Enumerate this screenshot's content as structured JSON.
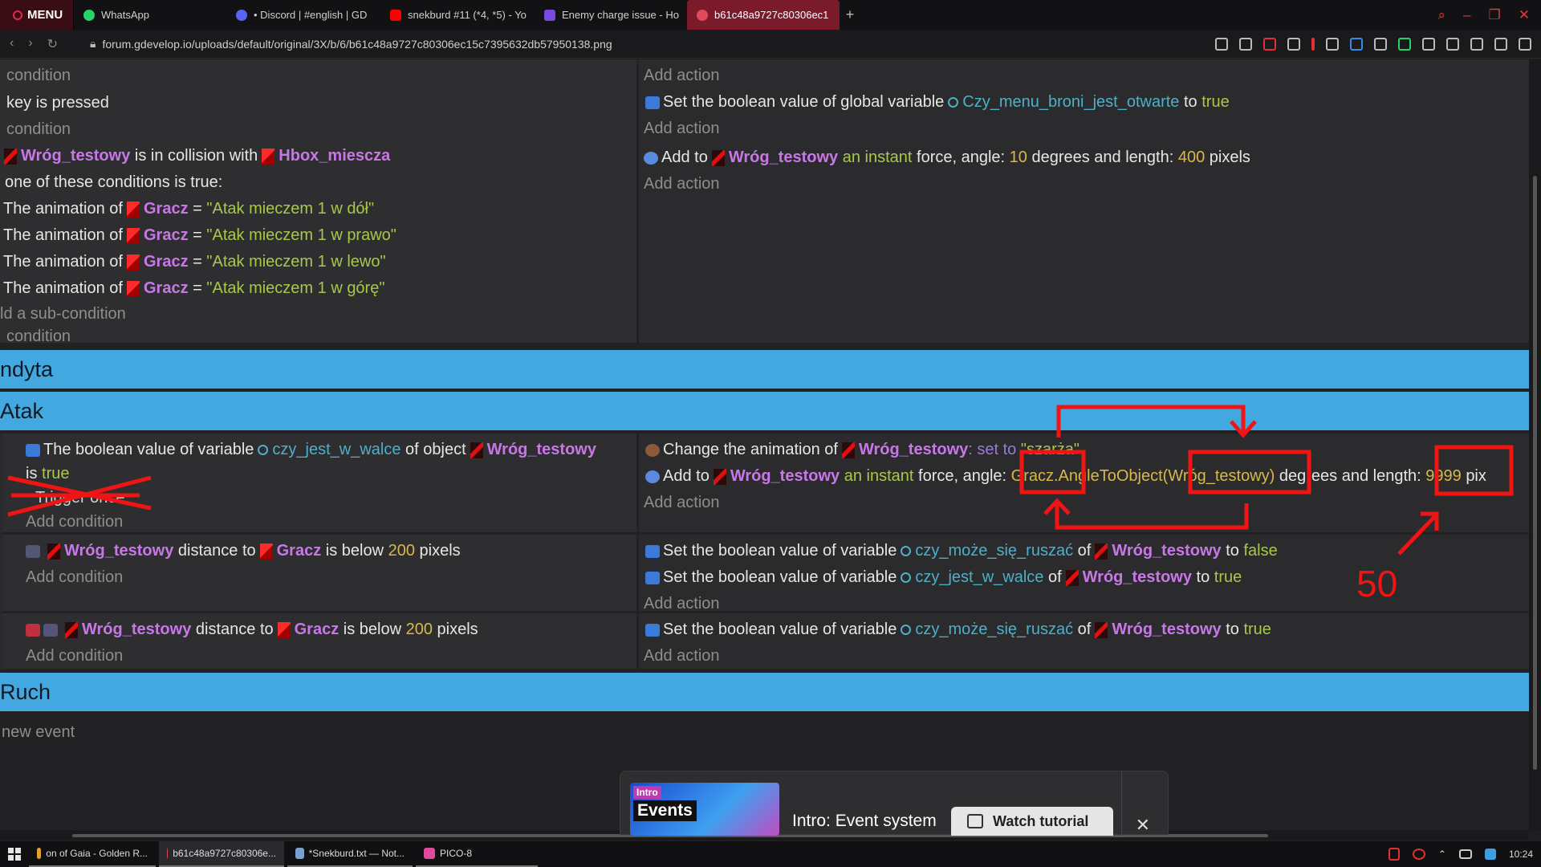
{
  "browser": {
    "menu_label": "MENU",
    "tabs": [
      {
        "label": "WhatsApp",
        "color": "#25d366"
      },
      {
        "label": "• Discord | #english | GD",
        "color": "#5865f2"
      },
      {
        "label": "snekburd #11 (*4, *5) - Yo",
        "color": "#ff0000"
      },
      {
        "label": "Enemy charge issue - Ho",
        "color": "#7a4ae0"
      },
      {
        "label": "b61c48a9727c80306ec1",
        "color": "#e04a5a"
      }
    ],
    "new_tab": "+",
    "url": "forum.gdevelop.io/uploads/default/original/3X/b/6/b61c48a9727c80306ec15c7395632db57950138.png",
    "window_controls": [
      "search-icon",
      "minimize-icon",
      "restore-icon",
      "close-icon"
    ]
  },
  "events": {
    "top": {
      "cond_line1": "condition",
      "act_line1": "Add action",
      "cond_key": "key is pressed",
      "cond_add": "condition",
      "act_set_bool_prefix": "Set the boolean value of global variable",
      "act_set_bool_var": "Czy_menu_broni_jest_otwarte",
      "act_set_bool_to": "to",
      "act_set_bool_val": "true",
      "act_add": "Add action"
    },
    "collision": {
      "obj1": "Wróg_testowy",
      "is_in_collision": "is in collision with",
      "obj2": "Hbox_miescza",
      "one_of": "one of these conditions is true:",
      "anim_prefix": "The animation of",
      "anim_obj": "Gracz",
      "eq": "=",
      "anims": [
        "\"Atak mieczem 1 w dół\"",
        "\"Atak mieczem 1 w prawo\"",
        "\"Atak mieczem 1 w lewo\"",
        "\"Atak mieczem 1 w górę\""
      ],
      "sub_cond": "ld a sub-condition",
      "add_cond": "condition",
      "action_add": "Add to",
      "action_obj": "Wróg_testowy",
      "action_instant": "an instant",
      "action_force": "force, angle:",
      "action_angle": "10",
      "action_deg": "degrees and length:",
      "action_len": "400",
      "action_px": "pixels",
      "action_add_action": "Add action"
    },
    "group_ndyta": "ndyta",
    "group_atak": "Atak",
    "atak1": {
      "cond_prefix": "The boolean value of variable",
      "cond_var": "czy_jest_w_walce",
      "cond_of": "of object",
      "cond_obj": "Wróg_testowy",
      "cond_is": "is",
      "cond_val": "true",
      "cond_crossed": "Trigger once",
      "cond_add": "Add condition",
      "act1_prefix": "Change the animation of",
      "act1_obj": "Wróg_testowy",
      "act1_set": ": set to",
      "act1_val": "\"szarża\"",
      "act2_add": "Add to",
      "act2_obj": "Wróg_testowy",
      "act2_instant": "an instant",
      "act2_force": "force, angle:",
      "act2_expr_a": "Gracz.AngleToObject(",
      "act2_expr_b": "Wróg_testowy)",
      "act2_deg": "degrees and length:",
      "act2_len": "9999",
      "act2_px": "pix",
      "act_add": "Add action"
    },
    "atak2": {
      "cond_obj": "Wróg_testowy",
      "cond_dist": "distance to",
      "cond_obj2": "Gracz",
      "cond_below": "is below",
      "cond_num": "200",
      "cond_px": "pixels",
      "cond_add": "Add condition",
      "act1_prefix": "Set the boolean value of variable",
      "act1_var": "czy_może_się_ruszać",
      "act1_of": "of",
      "act1_obj": "Wróg_testowy",
      "act1_to": "to",
      "act1_val": "false",
      "act2_prefix": "Set the boolean value of variable",
      "act2_var": "czy_jest_w_walce",
      "act2_of": "of",
      "act2_obj": "Wróg_testowy",
      "act2_to": "to",
      "act2_val": "true",
      "act_add": "Add action"
    },
    "atak3": {
      "cond_obj": "Wróg_testowy",
      "cond_dist": "distance to",
      "cond_obj2": "Gracz",
      "cond_below": "is below",
      "cond_num": "200",
      "cond_px": "pixels",
      "cond_add": "Add condition",
      "act1_prefix": "Set the boolean value of variable",
      "act1_var": "czy_może_się_ruszać",
      "act1_of": "of",
      "act1_obj": "Wróg_testowy",
      "act1_to": "to",
      "act1_val": "true",
      "act_add": "Add action"
    },
    "group_ruch": "Ruch",
    "new_event": "new event"
  },
  "annotation": {
    "number": "50",
    "color": "#f01414"
  },
  "tutorial": {
    "badge": "Intro",
    "thumb_title": "Events",
    "title": "Intro: Event system",
    "button": "Watch tutorial",
    "close": "✕"
  },
  "taskbar": {
    "items": [
      {
        "label": "on of Gaia - Golden R...",
        "color": "#e0a030"
      },
      {
        "label": "b61c48a9727c80306e...",
        "color": "#e04a5a"
      },
      {
        "label": "*Snekburd.txt — Not...",
        "color": "#7aa0d0"
      },
      {
        "label": "PICO-8",
        "color": "#e04a9a"
      }
    ],
    "time": "10:24"
  }
}
